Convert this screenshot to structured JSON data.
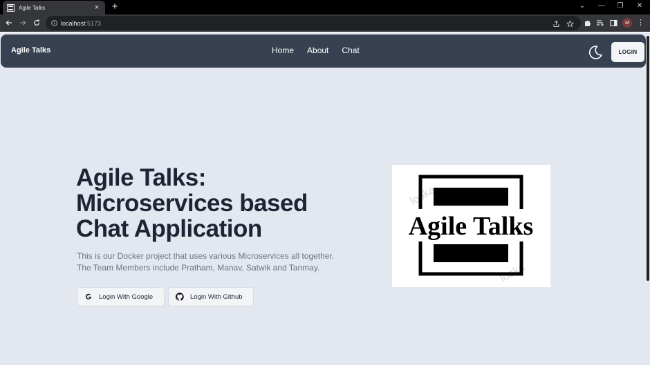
{
  "browser": {
    "tab_title": "Agile Talks",
    "tab_close": "×",
    "new_tab": "+",
    "url_host": "localhost",
    "url_port": ":5173",
    "profile_initial": "M",
    "window_controls": [
      "⌄",
      "—",
      "❐",
      "✕"
    ],
    "menu_glyph": "⋮"
  },
  "nav": {
    "brand": "Agile Talks",
    "links": [
      "Home",
      "About",
      "Chat"
    ],
    "login": "LOGIN"
  },
  "hero": {
    "title_lines": [
      "Agile Talks:",
      "Microservices based",
      "Chat Application"
    ],
    "description_lines": [
      "This is our Docker project that uses various Microservices all together.",
      "The Team Members include Pratham, Manav, Satwik and Tanmay."
    ],
    "buttons": {
      "google": "Login With Google",
      "github": "Login With Github"
    },
    "logo_text": "Agile Talks",
    "watermark": "looka"
  },
  "colors": {
    "page_bg": "#e3e8f0",
    "navbar_bg": "#374151",
    "title": "#1e2433",
    "description": "#6b7280"
  }
}
